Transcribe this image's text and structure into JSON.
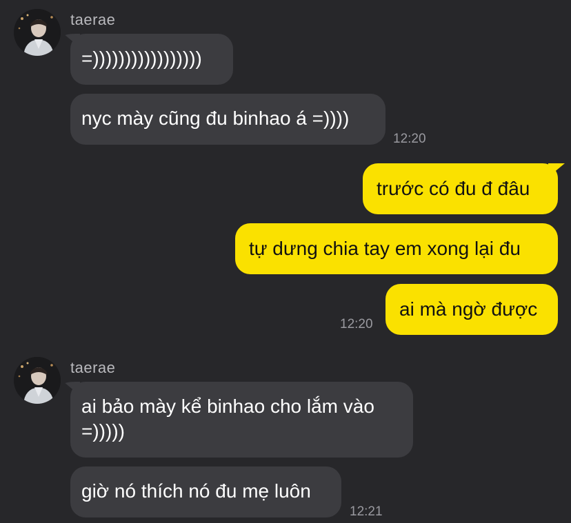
{
  "conversation": {
    "group1": {
      "sender": "taerae",
      "messages": [
        "=)))))))))))))))))",
        "nyc mày cũng đu binhao á =))))"
      ],
      "time": "12:20"
    },
    "group2": {
      "messages": [
        "trước có đu đ đâu",
        "tự dưng chia tay em xong lại đu",
        "ai mà ngờ được"
      ],
      "time": "12:20"
    },
    "group3": {
      "sender": "taerae",
      "messages": [
        "ai bảo mày kể binhao cho lắm vào",
        "=)))))",
        "giờ nó thích nó đu mẹ luôn"
      ],
      "time": "12:21"
    }
  },
  "colors": {
    "background": "#27272a",
    "incoming_bubble": "#3c3c40",
    "outgoing_bubble": "#fae100"
  },
  "icons": {
    "avatar": "avatar-photo"
  }
}
